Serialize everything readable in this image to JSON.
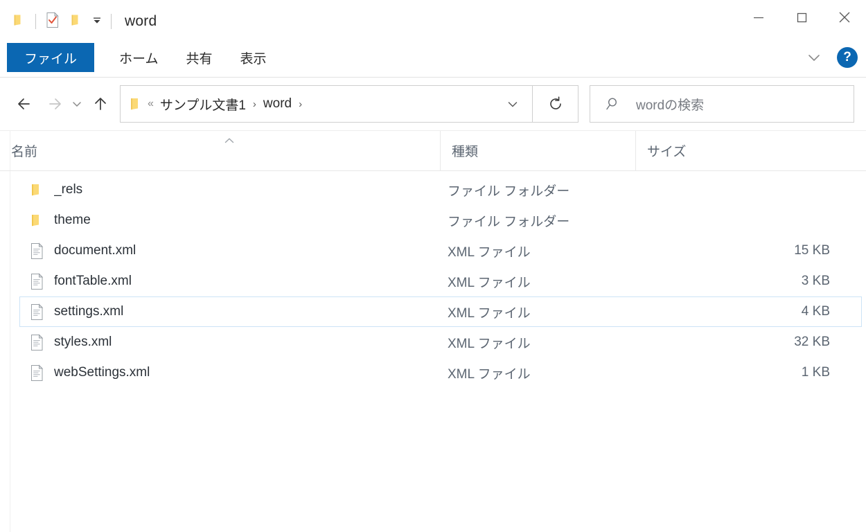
{
  "window": {
    "title": "word",
    "quick_access": [
      {
        "name": "folder-icon",
        "label": ""
      },
      {
        "name": "properties-checkmark-icon",
        "label": ""
      },
      {
        "name": "new-folder-icon",
        "label": ""
      },
      {
        "name": "customize-quick-access-dropdown-icon",
        "label": ""
      }
    ],
    "controls": {
      "minimize": "─",
      "maximize": "□",
      "close": "✕"
    }
  },
  "ribbon": {
    "tabs": [
      {
        "label": "ファイル",
        "selected": true
      },
      {
        "label": "ホーム",
        "selected": false
      },
      {
        "label": "共有",
        "selected": false
      },
      {
        "label": "表示",
        "selected": false
      }
    ],
    "collapse_icon": "chevron-down-icon",
    "help_label": "?",
    "accent_color": "#0b67b2"
  },
  "nav": {
    "back": "←",
    "forward": "→",
    "recent": "˅",
    "up": "↑",
    "breadcrumb": {
      "overflow": "«",
      "items": [
        "サンプル文書1",
        "word"
      ],
      "separator": "›",
      "trailing_separator": "›"
    },
    "address_dropdown": "˅",
    "refresh": "↻"
  },
  "search": {
    "icon": "search-icon",
    "placeholder": "wordの検索",
    "value": ""
  },
  "columns": {
    "name": "名前",
    "type": "種類",
    "size": "サイズ",
    "sort_column": "名前",
    "sort_direction": "ascending"
  },
  "files": [
    {
      "name": "_rels",
      "type": "ファイル フォルダー",
      "size": "",
      "icon": "folder-icon",
      "selected": false
    },
    {
      "name": "theme",
      "type": "ファイル フォルダー",
      "size": "",
      "icon": "folder-icon",
      "selected": false
    },
    {
      "name": "document.xml",
      "type": "XML ファイル",
      "size": "15 KB",
      "icon": "xml-file-icon",
      "selected": false
    },
    {
      "name": "fontTable.xml",
      "type": "XML ファイル",
      "size": "3 KB",
      "icon": "xml-file-icon",
      "selected": false
    },
    {
      "name": "settings.xml",
      "type": "XML ファイル",
      "size": "4 KB",
      "icon": "xml-file-icon",
      "selected": true
    },
    {
      "name": "styles.xml",
      "type": "XML ファイル",
      "size": "32 KB",
      "icon": "xml-file-icon",
      "selected": false
    },
    {
      "name": "webSettings.xml",
      "type": "XML ファイル",
      "size": "1 KB",
      "icon": "xml-file-icon",
      "selected": false
    }
  ],
  "colors": {
    "folder": "#fbd975",
    "folder_dark": "#f2c64d",
    "selection_border": "#cce3f6",
    "text": "#2b3138",
    "muted_text": "#5c6672"
  }
}
